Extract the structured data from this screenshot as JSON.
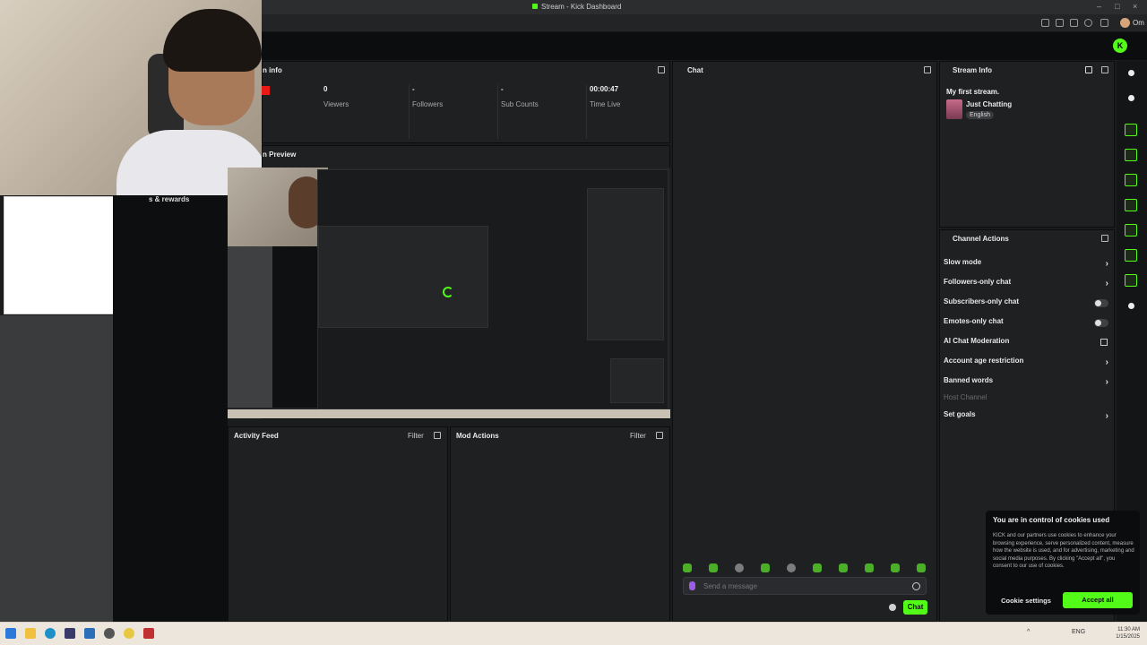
{
  "browser": {
    "window_title": "Stream - Kick Dashboard",
    "user_label": "Om"
  },
  "left_overlay": {
    "rewards_label": "s & rewards"
  },
  "stream_info_panel": {
    "title": "n info",
    "stats": [
      {
        "value": "0",
        "label": "Viewers"
      },
      {
        "value": "-",
        "label": "Followers"
      },
      {
        "value": "-",
        "label": "Sub Counts"
      },
      {
        "value": "00:00:47",
        "label": "Time Live"
      }
    ]
  },
  "preview_panel": {
    "title": "n Preview"
  },
  "activity_feed": {
    "title": "Activity Feed",
    "filter": "Filter"
  },
  "mod_actions": {
    "title": "Mod Actions",
    "filter": "Filter"
  },
  "chat": {
    "title": "Chat",
    "input_placeholder": "Send a message",
    "send_label": "Chat"
  },
  "stream_details": {
    "title": "Stream Info",
    "stream_title": "My first stream.",
    "category": "Just Chatting",
    "language_tag": "English"
  },
  "channel_actions": {
    "title": "Channel Actions",
    "items": [
      {
        "label": "Slow mode",
        "control": "chevron"
      },
      {
        "label": "Followers-only chat",
        "control": "chevron"
      },
      {
        "label": "Subscribers-only chat",
        "control": "toggle"
      },
      {
        "label": "Emotes-only chat",
        "control": "toggle"
      },
      {
        "label": "AI Chat Moderation",
        "control": "config"
      },
      {
        "label": "Account age restriction",
        "control": "chevron"
      },
      {
        "label": "Banned words",
        "control": "chevron"
      },
      {
        "label": "Host Channel",
        "control": "disabled"
      },
      {
        "label": "Set goals",
        "control": "chevron"
      }
    ]
  },
  "cookie_banner": {
    "title": "You are in control of cookies used",
    "body": "KICK and our partners use cookies to enhance your browsing experience, serve personalized content, measure how the website is used, and for advertising, marketing and social media purposes. By clicking \"Accept all\", you consent to our use of cookies.",
    "settings_label": "Cookie settings",
    "accept_label": "Accept all"
  },
  "taskbar": {
    "tray_text": "ENG",
    "time": "11:30 AM",
    "date": "1/15/2025"
  },
  "colors": {
    "accent": "#53fc18",
    "panel": "#1f2022",
    "background": "#1b1c1e",
    "live": "#e91916"
  }
}
